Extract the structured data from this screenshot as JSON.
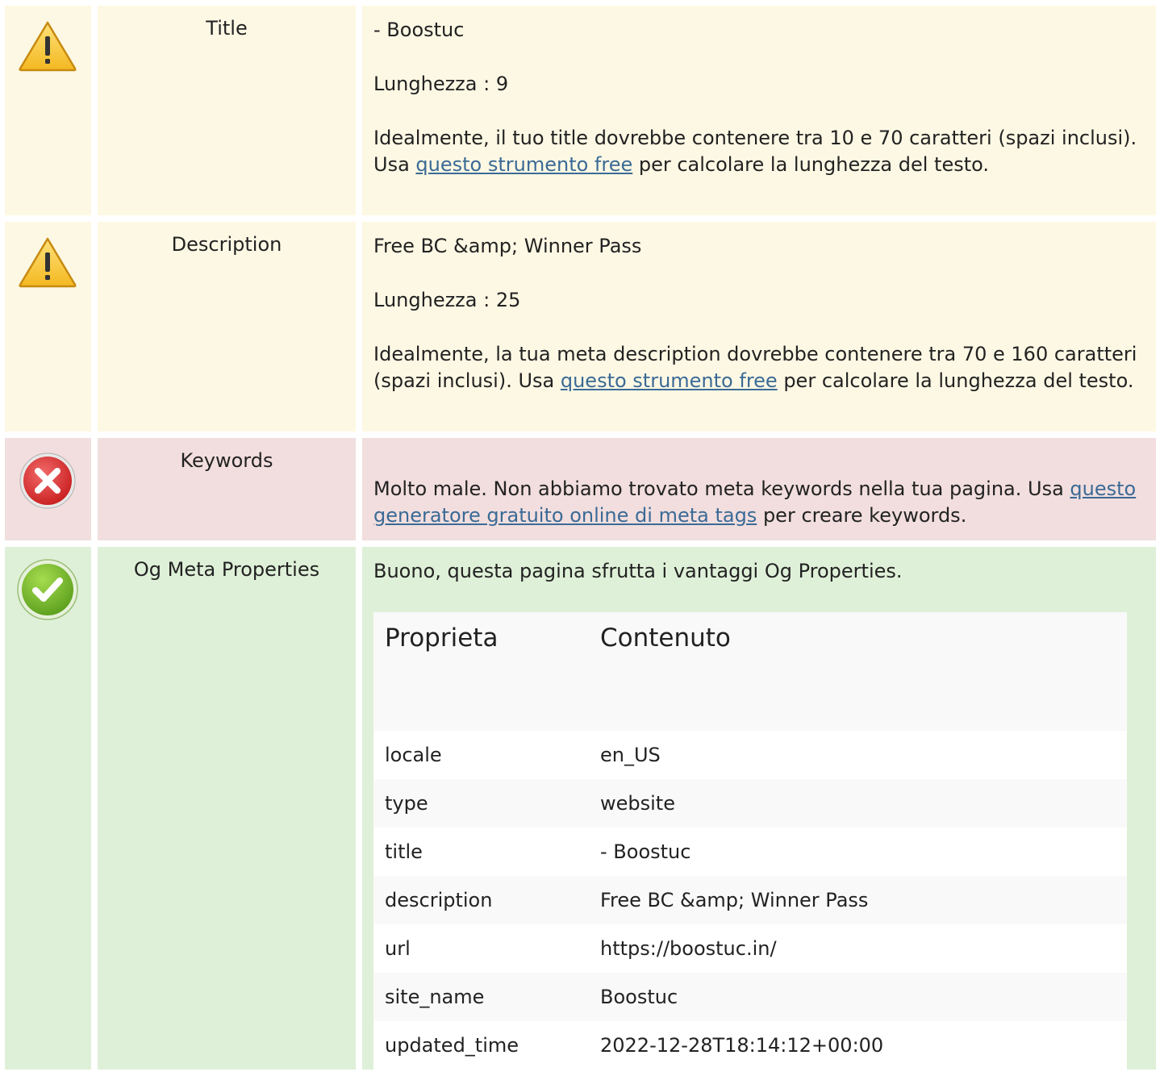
{
  "rows": {
    "title": {
      "label": "Title",
      "value": "- Boostuc",
      "length": "Lunghezza : 9",
      "hint_before": "Idealmente, il tuo title dovrebbe contenere tra 10 e 70 caratteri (spazi inclusi). Usa ",
      "hint_link": "questo strumento free",
      "hint_after": " per calcolare la lunghezza del testo."
    },
    "description": {
      "label": "Description",
      "value": "Free BC &amp; Winner Pass",
      "length": "Lunghezza : 25",
      "hint_before": "Idealmente, la tua meta description dovrebbe contenere tra 70 e 160 caratteri (spazi inclusi). Usa ",
      "hint_link": "questo strumento free",
      "hint_after": " per calcolare la lunghezza del testo."
    },
    "keywords": {
      "label": "Keywords",
      "text_before": "Molto male. Non abbiamo trovato meta keywords nella tua pagina. Usa ",
      "text_link": "questo generatore gratuito online di meta tags",
      "text_after": " per creare keywords."
    },
    "og": {
      "label": "Og Meta Properties",
      "intro": "Buono, questa pagina sfrutta i vantaggi Og Properties.",
      "col_property": "Proprieta",
      "col_content": "Contenuto",
      "items": [
        {
          "k": "locale",
          "v": "en_US"
        },
        {
          "k": "type",
          "v": "website"
        },
        {
          "k": "title",
          "v": "- Boostuc"
        },
        {
          "k": "description",
          "v": "Free BC &amp; Winner Pass"
        },
        {
          "k": "url",
          "v": "https://boostuc.in/"
        },
        {
          "k": "site_name",
          "v": "Boostuc"
        },
        {
          "k": "updated_time",
          "v": "2022-12-28T18:14:12+00:00"
        }
      ]
    }
  },
  "icons": {
    "warning": "warning-icon",
    "error": "error-icon",
    "success": "success-icon"
  },
  "colors": {
    "warn_bg": "#fdf8e4",
    "error_bg": "#f2dede",
    "ok_bg": "#dff0d8",
    "link": "#3a6a96"
  }
}
